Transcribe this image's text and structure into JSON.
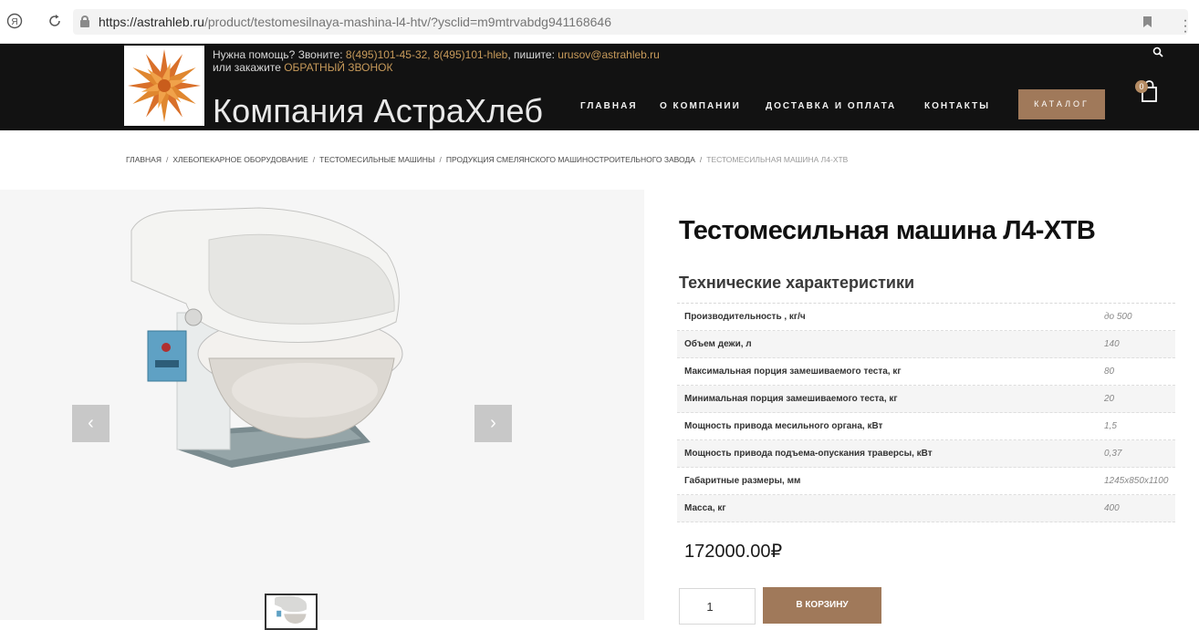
{
  "browser": {
    "url_domain": "https://astrahleb.ru",
    "url_path": "/product/testomesilnaya-mashina-l4-htv/?ysclid=m9mtrvabdg941168646"
  },
  "header": {
    "help_prefix": "Нужна помощь? Звоните: ",
    "phones": "8(495)101-45-32, 8(495)101-hleb",
    "write_label": ", пишите: ",
    "email": "urusov@astrahleb.ru",
    "order_prefix": "или закажите ",
    "callback": "ОБРАТНЫЙ ЗВОНОК",
    "brand": "Компания АстраХлеб",
    "nav": [
      "ГЛАВНАЯ",
      "О КОМПАНИИ",
      "ДОСТАВКА И ОПЛАТА",
      "КОНТАКТЫ"
    ],
    "catalog": "КАТАЛОГ",
    "cart_count": "0"
  },
  "breadcrumb": [
    "ГЛАВНАЯ",
    "ХЛЕБОПЕКАРНОЕ ОБОРУДОВАНИЕ",
    "ТЕСТОМЕСИЛЬНЫЕ МАШИНЫ",
    "ПРОДУКЦИЯ СМЕЛЯНСКОГО МАШИНОСТРОИТЕЛЬНОГО ЗАВОДА",
    "ТЕСТОМЕСИЛЬНАЯ МАШИНА Л4-ХТВ"
  ],
  "product": {
    "title": "Тестомесильная машина Л4-ХТВ",
    "specs_heading": "Технические характеристики",
    "specs": [
      {
        "name": "Производительность , кг/ч",
        "value": "до 500"
      },
      {
        "name": "Объем дежи, л",
        "value": "140"
      },
      {
        "name": "Максимальная порция замешиваемого теста, кг",
        "value": "80"
      },
      {
        "name": "Минимальная порция замешиваемого теста, кг",
        "value": "20"
      },
      {
        "name": "Мощность привода месильного органа, кВт",
        "value": "1,5"
      },
      {
        "name": "Мощность привода подъема-опускания траверсы, кВт",
        "value": "0,37"
      },
      {
        "name": "Габаритные размеры, мм",
        "value": "1245х850х1100"
      },
      {
        "name": "Масса, кг",
        "value": "400"
      }
    ],
    "price": "172000.00₽",
    "quantity": "1",
    "add_to_cart": "В КОРЗИНУ"
  },
  "gallery": {
    "prev_glyph": "‹",
    "next_glyph": "›"
  },
  "colors": {
    "header_bg": "#121212",
    "accent": "#a0795a",
    "link_gold": "#c79a5a"
  }
}
